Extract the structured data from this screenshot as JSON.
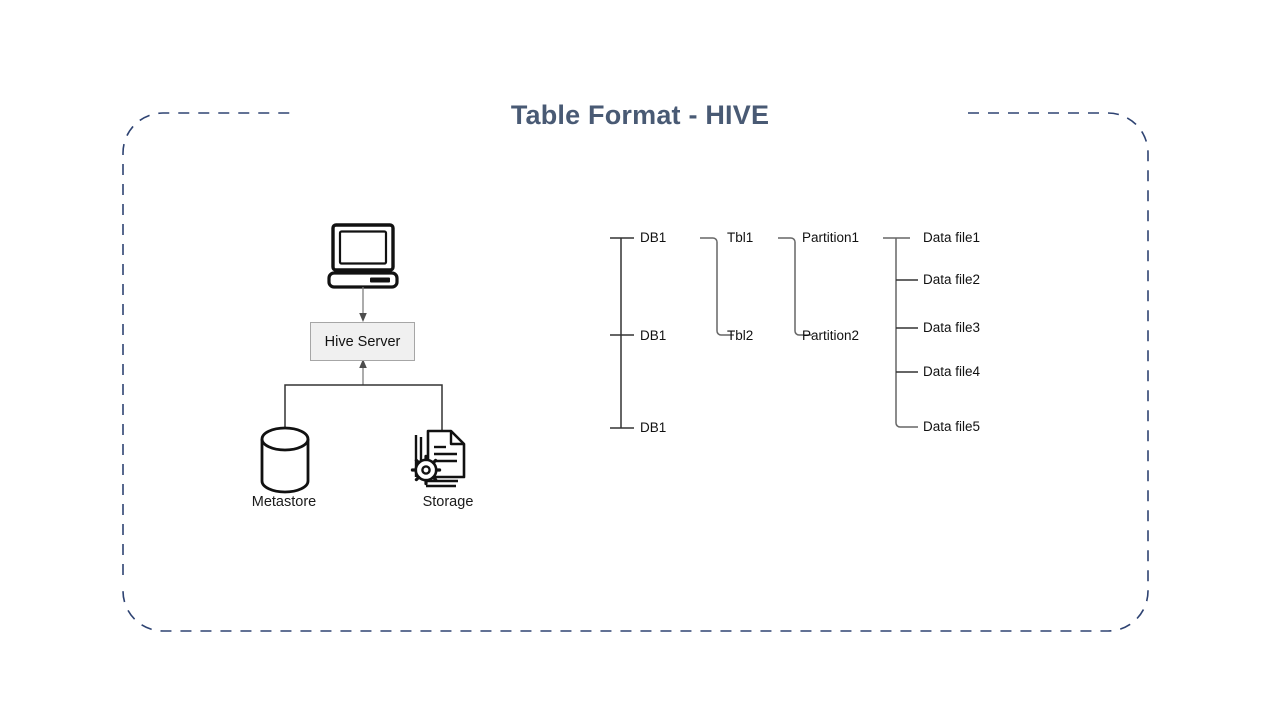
{
  "page": {
    "title": "Table Format - HIVE",
    "background_color": "#ffffff",
    "title_color": "#495a74",
    "border_color": "#2e4372"
  },
  "architecture": {
    "client_icon": "desktop-computer-icon",
    "server_box_label": "Hive Server",
    "nodes": [
      {
        "id": "metastore",
        "label": "Metastore",
        "icon": "database-cylinder-icon"
      },
      {
        "id": "storage",
        "label": "Storage",
        "icon": "document-gear-icon"
      }
    ]
  },
  "tree": {
    "columns": [
      {
        "id": "databases",
        "items": [
          {
            "label": "DB1"
          },
          {
            "label": "DB1"
          },
          {
            "label": "DB1"
          }
        ]
      },
      {
        "id": "tables",
        "items": [
          {
            "label": "Tbl1"
          },
          {
            "label": "Tbl2"
          }
        ]
      },
      {
        "id": "partitions",
        "items": [
          {
            "label": "Partition1"
          },
          {
            "label": "Partition2"
          }
        ]
      },
      {
        "id": "data-files",
        "items": [
          {
            "label": "Data file1"
          },
          {
            "label": "Data file2"
          },
          {
            "label": "Data file3"
          },
          {
            "label": "Data file4"
          },
          {
            "label": "Data file5"
          }
        ]
      }
    ]
  }
}
